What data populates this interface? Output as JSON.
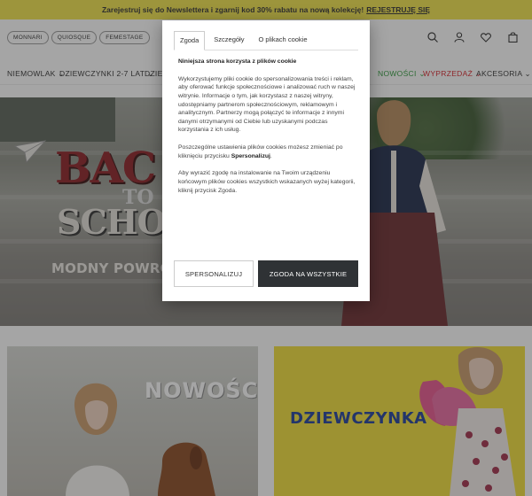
{
  "promo": {
    "text": "Zarejestruj się do Newslettera i zgarnij kod 30% rabatu na nową kolekcję!",
    "link": "REJESTRUJĘ SIĘ"
  },
  "brands": [
    "MONNARI",
    "QUIOSQUE",
    "FEMESTAGE"
  ],
  "header_icons": [
    "search-icon",
    "user-icon",
    "heart-icon",
    "bag-icon"
  ],
  "nav": [
    {
      "label": "NIEMOWLAK ⌄"
    },
    {
      "label": "DZIEWCZYNKI 2-7 LAT ⌄"
    },
    {
      "label": "DZIE"
    },
    {
      "label": "NOWOŚCI ⌄",
      "color": "#2f9a3c"
    },
    {
      "label": "WYPRZEDAŻ ⌄",
      "color": "#d8262d"
    },
    {
      "label": "AKCESORIA ⌄"
    }
  ],
  "hero": {
    "line1": "BAC",
    "line2": "TO",
    "line3": "SCHOO",
    "subtitle": "MODNY POWRÓT DO S"
  },
  "tiles": {
    "left_title": "NOWOŚCI",
    "right_title": "DZIEWCZYNKA"
  },
  "modal": {
    "tabs": [
      "Zgoda",
      "Szczegóły",
      "O plikach cookie"
    ],
    "active_tab": "Zgoda",
    "title": "Niniejsza strona korzysta z plików cookie",
    "para1": "Wykorzystujemy pliki cookie do spersonalizowania treści i reklam, aby oferować funkcje społecznościowe i analizować ruch w naszej witrynie. Informacje o tym, jak korzystasz z naszej witryny, udostępniamy partnerom społecznościowym, reklamowym i analitycznym. Partnerzy mogą połączyć te informacje z innymi danymi otrzymanymi od Ciebie lub uzyskanymi podczas korzystania z ich usług.",
    "para2_before": "Poszczególne ustawienia plików cookies możesz zmieniać po kliknięciu przycisku ",
    "para2_bold": "Spersonalizuj",
    "para2_after": ".",
    "para3": "Aby wyrazić zgodę na instalowanie na Twoim urządzeniu końcowym plików cookies wszystkich wskazanych wyżej kategorii, kliknij przycisk Zgoda.",
    "btn_personalize": "SPERSONALIZUJ",
    "btn_accept": "ZGODA NA WSZYSTKIE"
  },
  "colors": {
    "promo_bg": "#f1e34a",
    "accent_dark": "#2f3235",
    "nav_green": "#2f9a3c",
    "nav_red": "#d8262d",
    "tile_yellow": "#f2de3a",
    "tile_title_blue": "#1f3e9b"
  }
}
